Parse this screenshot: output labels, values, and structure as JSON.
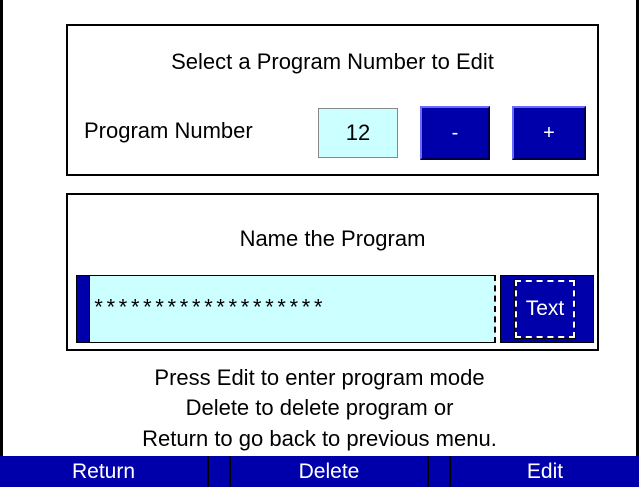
{
  "program_panel": {
    "title": "Select a Program Number to Edit",
    "number_label": "Program Number",
    "number_value": "12",
    "minus_label": "-",
    "plus_label": "+"
  },
  "name_panel": {
    "title": "Name the Program",
    "name_value": "*******************",
    "text_button_label": "Text"
  },
  "help": {
    "line1": "Press Edit to enter program mode",
    "line2": "Delete to delete program or",
    "line3": "Return to go back to previous menu."
  },
  "softkeys": {
    "return_label": "Return",
    "delete_label": "Delete",
    "edit_label": "Edit"
  },
  "colors": {
    "button_blue": "#0000aa",
    "field_cyan": "#ccffff"
  }
}
